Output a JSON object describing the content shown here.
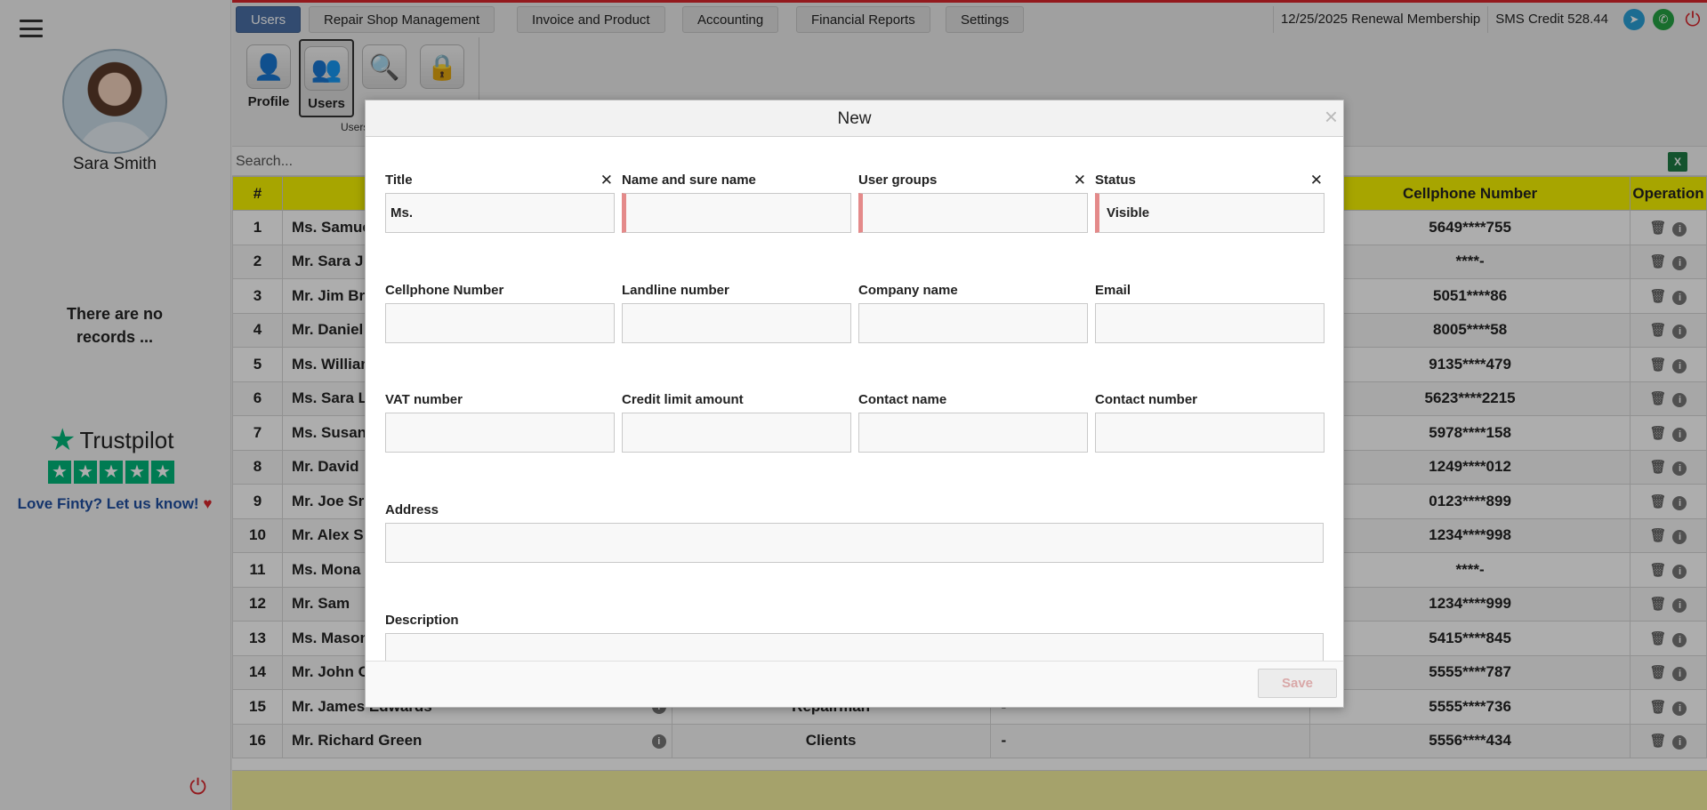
{
  "sidebar": {
    "user_name": "Sara Smith",
    "no_records": "There are no records ...",
    "trustpilot": {
      "brand": "Trustpilot",
      "prompt": "Love Finty? Let us know!"
    }
  },
  "topnav": {
    "tabs": [
      {
        "label": "Users",
        "active": true
      },
      {
        "label": "Repair Shop Management"
      },
      {
        "label": "Invoice and Product"
      },
      {
        "label": "Accounting"
      },
      {
        "label": "Financial Reports"
      },
      {
        "label": "Settings"
      }
    ],
    "renewal": "12/25/2025 Renewal Membership",
    "sms_credit": "SMS Credit 528.44"
  },
  "toolbar": {
    "profile_label": "Profile",
    "users_label": "Users",
    "group_caption": "Users"
  },
  "search": {
    "placeholder": "Search..."
  },
  "table": {
    "headers": {
      "num": "#",
      "phone": "Cellphone Number",
      "operation": "Operation"
    },
    "rows": [
      {
        "num": "1",
        "name": "Ms. Samuel",
        "group": "",
        "company": "",
        "phone": "5649****755"
      },
      {
        "num": "2",
        "name": "Mr. Sara J",
        "group": "",
        "company": "",
        "phone": "****-"
      },
      {
        "num": "3",
        "name": "Mr. Jim Br",
        "group": "",
        "company": "",
        "phone": "5051****86"
      },
      {
        "num": "4",
        "name": "Mr. Daniel",
        "group": "",
        "company": "",
        "phone": "8005****58"
      },
      {
        "num": "5",
        "name": "Ms. William",
        "group": "",
        "company": "",
        "phone": "9135****479"
      },
      {
        "num": "6",
        "name": "Ms. Sara L",
        "group": "",
        "company": "",
        "phone": "5623****2215"
      },
      {
        "num": "7",
        "name": "Ms. Susan",
        "group": "",
        "company": "",
        "phone": "5978****158"
      },
      {
        "num": "8",
        "name": "Mr. David",
        "group": "",
        "company": "",
        "phone": "1249****012"
      },
      {
        "num": "9",
        "name": "Mr. Joe Sr",
        "group": "",
        "company": "",
        "phone": "0123****899"
      },
      {
        "num": "10",
        "name": "Mr. Alex S",
        "group": "",
        "company": "",
        "phone": "1234****998"
      },
      {
        "num": "11",
        "name": "Ms. Mona",
        "group": "",
        "company": "",
        "phone": "****-"
      },
      {
        "num": "12",
        "name": "Mr. Sam",
        "group": "",
        "company": "",
        "phone": "1234****999"
      },
      {
        "num": "13",
        "name": "Ms. Mason",
        "group": "",
        "company": "",
        "phone": "5415****845"
      },
      {
        "num": "14",
        "name": "Mr. John C",
        "group": "",
        "company": "",
        "phone": "5555****787"
      },
      {
        "num": "15",
        "name": "Mr. James Edwards",
        "group": "Repairman",
        "company": "-",
        "phone": "5555****736"
      },
      {
        "num": "16",
        "name": "Mr. Richard Green",
        "group": "Clients",
        "company": "-",
        "phone": "5556****434"
      }
    ]
  },
  "modal": {
    "title": "New",
    "fields": {
      "title": {
        "label": "Title",
        "value": "Ms."
      },
      "name": {
        "label": "Name and sure name",
        "value": ""
      },
      "user_groups": {
        "label": "User groups",
        "value": ""
      },
      "status": {
        "label": "Status",
        "value": "Visible"
      },
      "cellphone": {
        "label": "Cellphone Number",
        "value": ""
      },
      "landline": {
        "label": "Landline number",
        "value": ""
      },
      "company": {
        "label": "Company name",
        "value": ""
      },
      "email": {
        "label": "Email",
        "value": ""
      },
      "vat": {
        "label": "VAT number",
        "value": ""
      },
      "credit_limit": {
        "label": "Credit limit amount",
        "value": ""
      },
      "contact_name": {
        "label": "Contact name",
        "value": ""
      },
      "contact_number": {
        "label": "Contact number",
        "value": ""
      },
      "address": {
        "label": "Address",
        "value": ""
      },
      "description": {
        "label": "Description",
        "value": ""
      }
    },
    "save_label": "Save"
  },
  "colors": {
    "accent_red": "#d9262c",
    "header_yellow": "#f7f300",
    "active_tab": "#4a6fa5",
    "required_marker": "#e48a8a"
  },
  "icons": [
    "hamburger-icon",
    "telegram-icon",
    "whatsapp-icon",
    "logout-icon",
    "excel-icon",
    "trash-icon",
    "info-icon",
    "close-icon",
    "search-icon",
    "lock-icon"
  ]
}
